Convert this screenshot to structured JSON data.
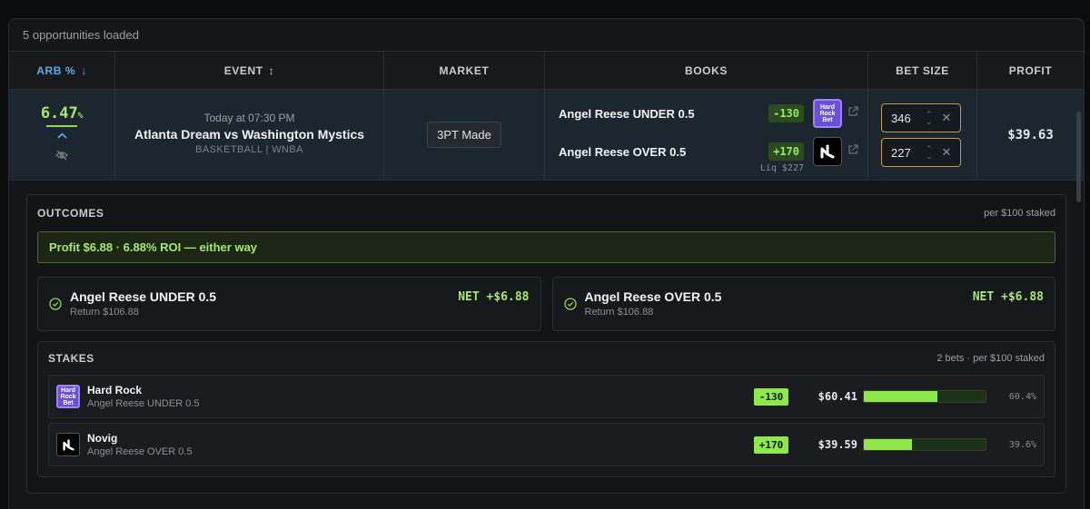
{
  "status": {
    "loaded_text": "5 opportunities loaded"
  },
  "table": {
    "headers": {
      "arb": "ARB %",
      "event": "EVENT",
      "market": "MARKET",
      "books": "BOOKS",
      "bet_size": "BET SIZE",
      "profit": "PROFIT"
    },
    "row": {
      "arb_value": "6.47",
      "arb_unit": "%",
      "event_time": "Today at 07:30 PM",
      "event_name": "Atlanta Dream vs Washington Mystics",
      "event_league": "BASKETBALL | WNBA",
      "market": "3PT Made",
      "books": [
        {
          "selection": "Angel Reese UNDER 0.5",
          "odds": "-130",
          "logo": "hard-rock-logo",
          "liq": ""
        },
        {
          "selection": "Angel Reese OVER 0.5",
          "odds": "+170",
          "logo": "novig-logo",
          "liq": "Liq $227"
        }
      ],
      "bets": [
        {
          "value": "346"
        },
        {
          "value": "227"
        }
      ],
      "profit": "$39.63"
    }
  },
  "outcomes": {
    "title": "OUTCOMES",
    "meta": "per $100 staked",
    "summary": "Profit $6.88 · 6.88% ROI — either way",
    "cards": [
      {
        "selection": "Angel Reese UNDER 0.5",
        "return": "Return $106.88",
        "net": "NET +$6.88"
      },
      {
        "selection": "Angel Reese OVER 0.5",
        "return": "Return $106.88",
        "net": "NET +$6.88"
      }
    ]
  },
  "stakes": {
    "title": "STAKES",
    "meta": "2 bets · per $100 staked",
    "rows": [
      {
        "book": "Hard Rock",
        "selection": "Angel Reese UNDER 0.5",
        "odds": "-130",
        "amount": "$60.41",
        "pct": "60.4%",
        "fraction": 0.604
      },
      {
        "book": "Novig",
        "selection": "Angel Reese OVER 0.5",
        "odds": "+170",
        "amount": "$39.59",
        "pct": "39.6%",
        "fraction": 0.396
      }
    ]
  },
  "logos": {
    "hard_rock_text": "Hard Rock Bet"
  },
  "colors": {
    "accent_green": "#a8e86b",
    "accent_blue": "#5aaee8",
    "input_border": "#c89a3a"
  }
}
